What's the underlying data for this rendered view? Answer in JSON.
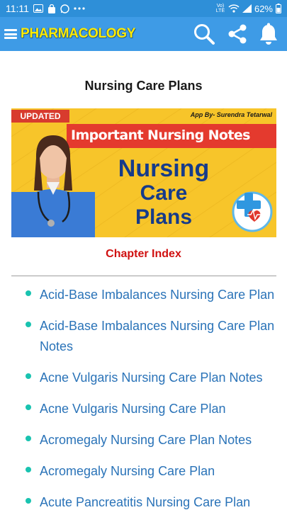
{
  "status_bar": {
    "time": "11:11",
    "network": "Vo) LTE",
    "battery": "62%",
    "icons": [
      "gallery-icon",
      "bag-icon",
      "whatsapp-icon",
      "more-icon",
      "wifi-icon",
      "signal-icon",
      "battery-icon"
    ]
  },
  "app_bar": {
    "title": "PHARMACOLOGY",
    "icons": [
      "menu-icon",
      "search-icon",
      "share-icon",
      "bell-icon"
    ],
    "title_color": "#ffea00",
    "background": "#3e9be6"
  },
  "page": {
    "title": "Nursing Care Plans"
  },
  "banner": {
    "tag": "UPDATED",
    "credit": "App By- Surendra Tetarwal",
    "headline": "Important Nursing Notes",
    "line1": "Nursing",
    "line2": "Care",
    "line3": "Plans",
    "background": "#f7c52a"
  },
  "chapter_index": {
    "heading": "Chapter Index",
    "items": [
      "Acid-Base Imbalances Nursing Care Plan",
      "Acid-Base Imbalances Nursing Care Plan Notes",
      "Acne Vulgaris Nursing Care Plan Notes",
      "Acne Vulgaris Nursing Care Plan",
      "Acromegaly Nursing Care Plan Notes",
      "Acromegaly Nursing Care Plan",
      "Acute Pancreatitis Nursing Care Plan"
    ]
  },
  "colors": {
    "link": "#2a73b8",
    "bullet": "#19c3b0",
    "index_heading": "#d01010"
  }
}
